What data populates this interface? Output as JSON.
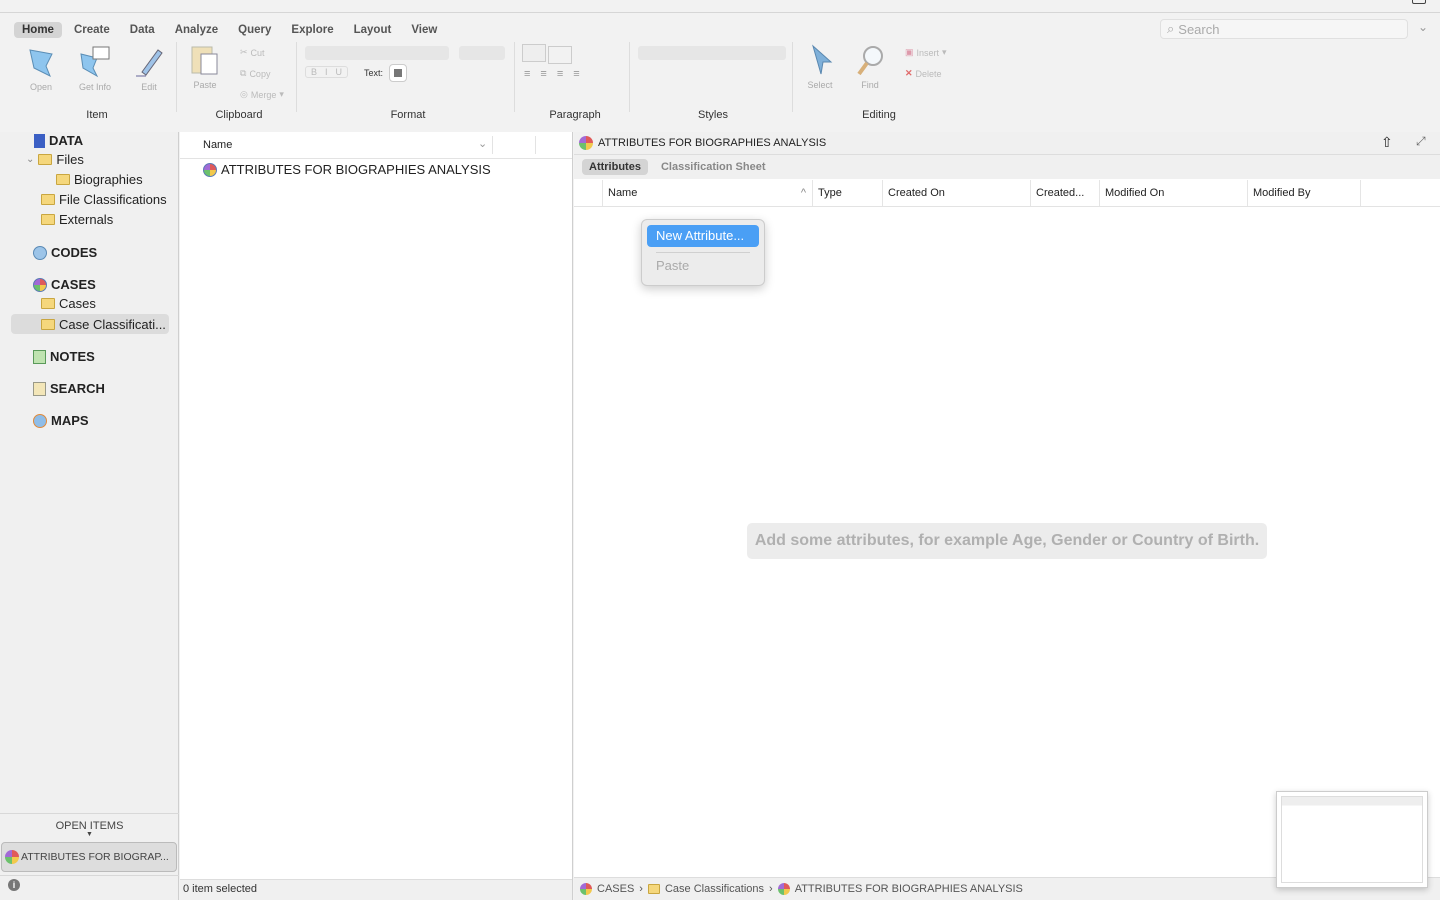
{
  "ribbon": {
    "tabs": [
      "Home",
      "Create",
      "Data",
      "Analyze",
      "Query",
      "Explore",
      "Layout",
      "View"
    ],
    "active_tab": "Home",
    "item": {
      "open": "Open",
      "get_info": "Get Info",
      "edit": "Edit",
      "label": "Item"
    },
    "clipboard": {
      "paste": "Paste",
      "cut": "Cut",
      "copy": "Copy",
      "merge": "Merge",
      "label": "Clipboard"
    },
    "format": {
      "bold": "B",
      "italic": "I",
      "underline": "U",
      "text_label": "Text:",
      "label": "Format"
    },
    "paragraph": {
      "label": "Paragraph"
    },
    "styles": {
      "label": "Styles"
    },
    "editing": {
      "select": "Select",
      "find": "Find",
      "insert": "Insert",
      "delete": "Delete",
      "label": "Editing"
    },
    "search_placeholder": "Search"
  },
  "sidebar": {
    "data": "DATA",
    "files": "Files",
    "biographies": "Biographies",
    "file_classifications": "File Classifications",
    "externals": "Externals",
    "codes": "CODES",
    "cases": "CASES",
    "cases_folder": "Cases",
    "case_classifications": "Case Classificati...",
    "notes": "NOTES",
    "search": "SEARCH",
    "maps": "MAPS",
    "open_items": "OPEN ITEMS",
    "open_item": "ATTRIBUTES FOR BIOGRAP..."
  },
  "list": {
    "column": "Name",
    "items": [
      "ATTRIBUTES FOR BIOGRAPHIES ANALYSIS"
    ],
    "status": "0 item selected"
  },
  "detail": {
    "title": "ATTRIBUTES FOR BIOGRAPHIES ANALYSIS",
    "tabs": [
      "Attributes",
      "Classification Sheet"
    ],
    "columns": [
      "Name",
      "Type",
      "Created On",
      "Created...",
      "Modified On",
      "Modified By"
    ],
    "context_menu": [
      "New Attribute...",
      "Paste"
    ],
    "hint": "Add some attributes, for example Age, Gender or Country of Birth.",
    "breadcrumb": [
      "CASES",
      "Case Classifications",
      "ATTRIBUTES FOR BIOGRAPHIES ANALYSIS"
    ]
  },
  "colors": {
    "accent": "#4a9ff5"
  }
}
